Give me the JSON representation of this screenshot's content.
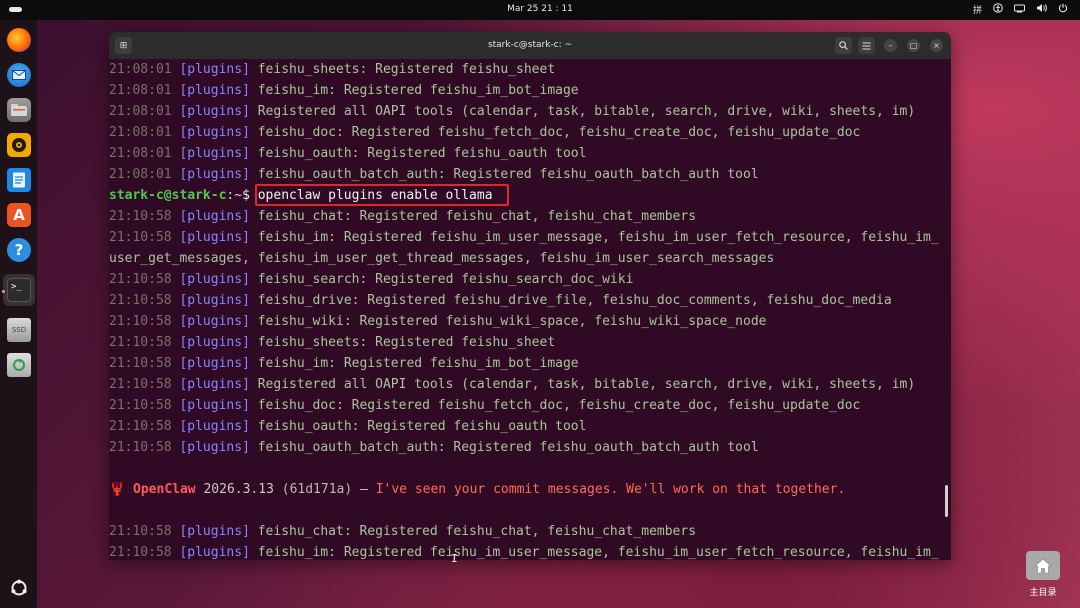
{
  "topbar": {
    "clock": "Mar 25  21 : 11",
    "input_method": "拼",
    "tray_icons": [
      "accessibility-icon",
      "network-icon",
      "volume-icon",
      "power-icon"
    ]
  },
  "dock": {
    "apps": [
      {
        "name": "firefox",
        "glyph": "🦊"
      },
      {
        "name": "thunderbird",
        "glyph": "✉"
      },
      {
        "name": "files",
        "glyph": "▤"
      },
      {
        "name": "rhythmbox",
        "glyph": "◉"
      },
      {
        "name": "libreoffice-writer",
        "glyph": "≡"
      },
      {
        "name": "app-center",
        "glyph": "A"
      },
      {
        "name": "help",
        "glyph": "?"
      },
      {
        "name": "terminal",
        "glyph": ">_"
      },
      {
        "name": "ssd-drive",
        "glyph": "SSD"
      },
      {
        "name": "trash",
        "glyph": "♻"
      },
      {
        "name": "show-apps",
        "glyph": "⋮⋮"
      }
    ]
  },
  "window": {
    "title": "stark-c@stark-c: ~",
    "buttons": {
      "new_tab": "⊞",
      "search": "⌕",
      "menu": "≡",
      "minimize": "–",
      "maximize": "□",
      "close": "×"
    }
  },
  "terminal": {
    "lines_top": [
      {
        "ts": "21:08:01",
        "tag": "[plugins]",
        "msg": "feishu_sheets: Registered feishu_sheet"
      },
      {
        "ts": "21:08:01",
        "tag": "[plugins]",
        "msg": "feishu_im: Registered feishu_im_bot_image"
      },
      {
        "ts": "21:08:01",
        "tag": "[plugins]",
        "msg": "Registered all OAPI tools (calendar, task, bitable, search, drive, wiki, sheets, im)"
      },
      {
        "ts": "21:08:01",
        "tag": "[plugins]",
        "msg": "feishu_doc: Registered feishu_fetch_doc, feishu_create_doc, feishu_update_doc"
      },
      {
        "ts": "21:08:01",
        "tag": "[plugins]",
        "msg": "feishu_oauth: Registered feishu_oauth tool"
      },
      {
        "ts": "21:08:01",
        "tag": "[plugins]",
        "msg": "feishu_oauth_batch_auth: Registered feishu_oauth_batch_auth tool"
      }
    ],
    "prompt": {
      "user": "stark-c@stark-c",
      "sep": ":",
      "path": "~",
      "symbol": "$",
      "command": "openclaw plugins enable ollama"
    },
    "lines_mid": [
      {
        "ts": "21:10:58",
        "tag": "[plugins]",
        "msg": "feishu_chat: Registered feishu_chat, feishu_chat_members"
      },
      {
        "ts": "21:10:58",
        "tag": "[plugins]",
        "msg": "feishu_im: Registered feishu_im_user_message, feishu_im_user_fetch_resource, feishu_im_"
      },
      {
        "ts": "",
        "tag": "",
        "msg": "user_get_messages, feishu_im_user_get_thread_messages, feishu_im_user_search_messages"
      },
      {
        "ts": "21:10:58",
        "tag": "[plugins]",
        "msg": "feishu_search: Registered feishu_search_doc_wiki"
      },
      {
        "ts": "21:10:58",
        "tag": "[plugins]",
        "msg": "feishu_drive: Registered feishu_drive_file, feishu_doc_comments, feishu_doc_media"
      },
      {
        "ts": "21:10:58",
        "tag": "[plugins]",
        "msg": "feishu_wiki: Registered feishu_wiki_space, feishu_wiki_space_node"
      },
      {
        "ts": "21:10:58",
        "tag": "[plugins]",
        "msg": "feishu_sheets: Registered feishu_sheet"
      },
      {
        "ts": "21:10:58",
        "tag": "[plugins]",
        "msg": "feishu_im: Registered feishu_im_bot_image"
      },
      {
        "ts": "21:10:58",
        "tag": "[plugins]",
        "msg": "Registered all OAPI tools (calendar, task, bitable, search, drive, wiki, sheets, im)"
      },
      {
        "ts": "21:10:58",
        "tag": "[plugins]",
        "msg": "feishu_doc: Registered feishu_fetch_doc, feishu_create_doc, feishu_update_doc"
      },
      {
        "ts": "21:10:58",
        "tag": "[plugins]",
        "msg": "feishu_oauth: Registered feishu_oauth tool"
      },
      {
        "ts": "21:10:58",
        "tag": "[plugins]",
        "msg": "feishu_oauth_batch_auth: Registered feishu_oauth_batch_auth tool"
      }
    ],
    "banner": {
      "icon": "🦞",
      "name": "OpenClaw",
      "version": "2026.3.13",
      "hash": "(61d171a)",
      "dash": "—",
      "tagline": "I've seen your commit messages. We'll work on that together."
    },
    "lines_bottom": [
      {
        "ts": "21:10:58",
        "tag": "[plugins]",
        "msg": "feishu_chat: Registered feishu_chat, feishu_chat_members"
      },
      {
        "ts": "21:10:58",
        "tag": "[plugins]",
        "msg": "feishu_im: Registered feishu_im_user_message, feishu_im_user_fetch_resource, feishu_im_"
      }
    ]
  },
  "desktop": {
    "home_label": "主目录"
  },
  "colors": {
    "terminal_bg": "#300a24",
    "timestamp": "#7a7166",
    "plugin_tag": "#8585ff",
    "message": "#a9c49a",
    "prompt_user": "#4ec94e",
    "highlight_box": "#e0262a",
    "banner": "#ff5a5a"
  }
}
